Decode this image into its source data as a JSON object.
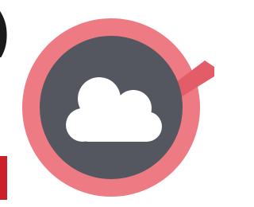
{
  "edge": {
    "glyph": ")",
    "glyph_color": "#1a1a1a",
    "block_color": "#cc1f2a"
  },
  "logo": {
    "icon": "cloud-icon",
    "ring_color": "#ee7b84",
    "disk_color": "#545660",
    "cloud_color": "#ffffff",
    "beam_color": "#e35d69"
  }
}
